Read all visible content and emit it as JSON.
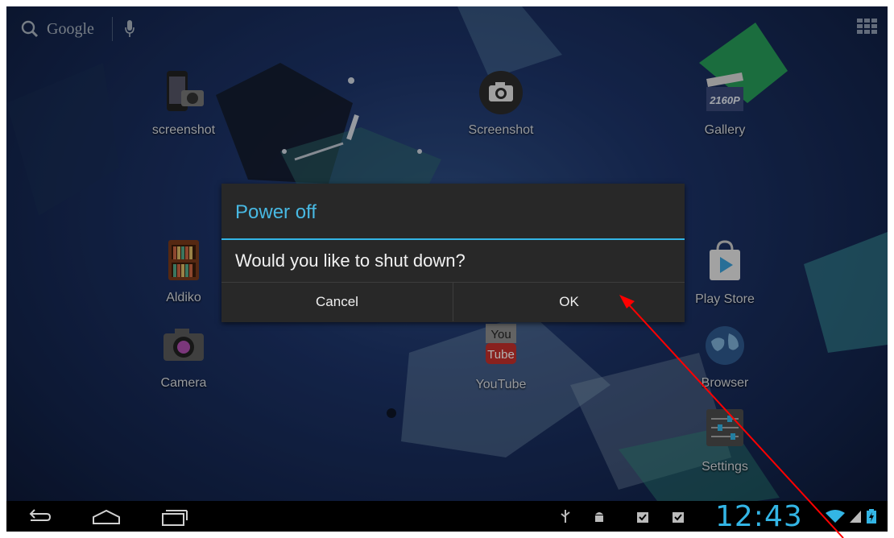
{
  "search": {
    "label": "Google",
    "search_icon": "search-icon",
    "voice_icon": "mic-icon"
  },
  "apps_button_icon": "apps-grid-icon",
  "apps": [
    {
      "label": "screenshot",
      "icon": "phone-camera-icon"
    },
    {
      "label": "Screenshot",
      "icon": "camera-round-icon"
    },
    {
      "label": "Gallery",
      "icon": "clapper-icon",
      "icon_text": "2160P"
    },
    {
      "label": "Aldiko",
      "icon": "bookshelf-icon"
    },
    {
      "label": "Camera",
      "icon": "camera-icon"
    },
    {
      "label": "YouTube",
      "icon": "youtube-icon",
      "icon_text_top": "You",
      "icon_text_bottom": "Tube"
    },
    {
      "label": "Play Store",
      "icon": "play-store-icon"
    },
    {
      "label": "Browser",
      "icon": "globe-icon"
    },
    {
      "label": "Settings",
      "icon": "sliders-icon"
    }
  ],
  "dialog": {
    "title": "Power off",
    "message": "Would you like to shut down?",
    "cancel_label": "Cancel",
    "ok_label": "OK"
  },
  "navbar": {
    "back_icon": "back-icon",
    "home_icon": "home-icon",
    "recents_icon": "recents-icon"
  },
  "status": {
    "clock": "12:43",
    "icons": [
      "usb-icon",
      "android-debug-icon",
      "download-done-icon",
      "download-done-icon",
      "wifi-icon",
      "signal-icon",
      "battery-icon"
    ]
  },
  "colors": {
    "accent": "#33b5e5",
    "annotation": "#ff0000"
  }
}
